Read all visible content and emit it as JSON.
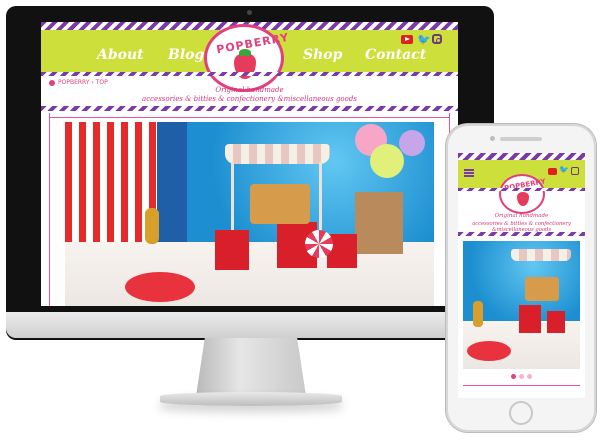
{
  "brand": {
    "name": "POPBERRY"
  },
  "nav": {
    "items": [
      {
        "label": "About"
      },
      {
        "label": "Blog"
      },
      {
        "label": "Shop"
      },
      {
        "label": "Contact"
      }
    ]
  },
  "social": {
    "icons": [
      "youtube-icon",
      "twitter-icon",
      "instagram-icon"
    ]
  },
  "breadcrumb": {
    "text": "POPBERRY › TOP"
  },
  "tagline": {
    "line1": "Original handmade",
    "line2": "accessories & bitties & confectionery &miscellaneous goods"
  },
  "colors": {
    "lime": "#cddf3a",
    "purple_stripe": "#7b3aa7",
    "pink": "#e23f7d"
  },
  "carousel": {
    "dots_count": 3,
    "active_index": 0
  }
}
